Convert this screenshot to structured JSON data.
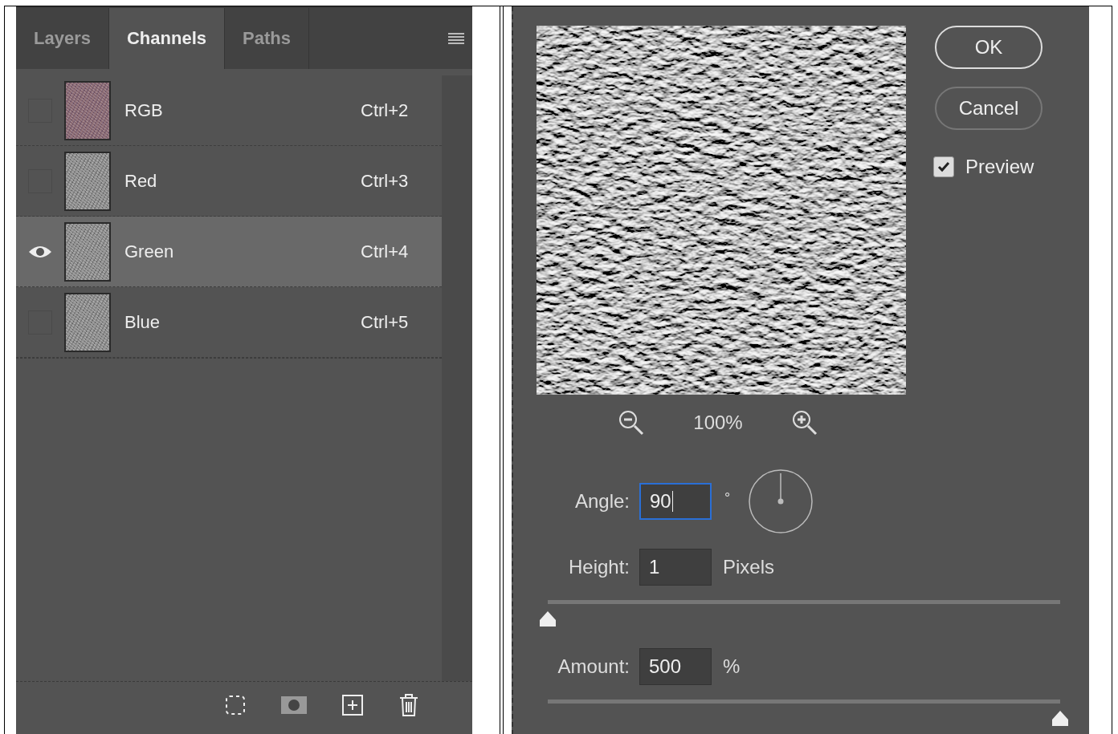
{
  "channels_panel": {
    "tabs": [
      {
        "label": "Layers",
        "selected": false
      },
      {
        "label": "Channels",
        "selected": true
      },
      {
        "label": "Paths",
        "selected": false
      }
    ],
    "channels": [
      {
        "name": "RGB",
        "shortcut": "Ctrl+2",
        "kind": "composite",
        "visible": false,
        "selected": false
      },
      {
        "name": "Red",
        "shortcut": "Ctrl+3",
        "kind": "channel",
        "visible": false,
        "selected": false
      },
      {
        "name": "Green",
        "shortcut": "Ctrl+4",
        "kind": "channel",
        "visible": true,
        "selected": true
      },
      {
        "name": "Blue",
        "shortcut": "Ctrl+5",
        "kind": "channel",
        "visible": false,
        "selected": false
      }
    ]
  },
  "emboss_dialog": {
    "zoom": "100%",
    "buttons": [
      "OK",
      "Cancel"
    ],
    "preview": {
      "label": "Preview",
      "checked": true
    },
    "angle": {
      "label": "Angle:",
      "value": "90",
      "unit": "°"
    },
    "height": {
      "label": "Height:",
      "value": "1",
      "unit": "Pixels",
      "level": 0
    },
    "amount": {
      "label": "Amount:",
      "value": "500",
      "unit": "%",
      "level": 1
    }
  }
}
